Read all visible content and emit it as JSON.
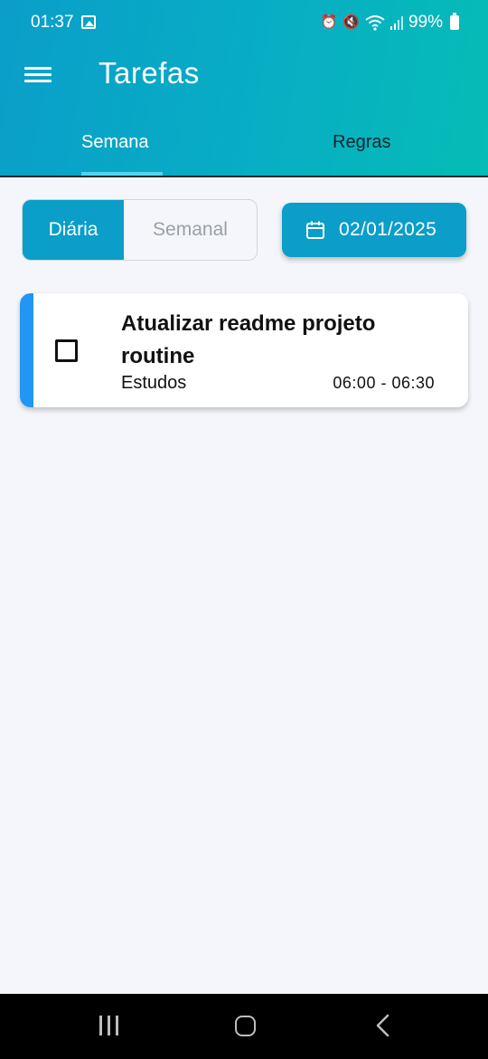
{
  "status_bar": {
    "time": "01:37",
    "battery": "99%",
    "icons": [
      "gallery-icon",
      "alarm-icon",
      "mute-icon",
      "wifi-icon",
      "signal-icon",
      "battery-icon"
    ]
  },
  "app_bar": {
    "title": "Tarefas",
    "menu_icon": "menu-icon"
  },
  "tabs": [
    {
      "label": "Semana",
      "active": true
    },
    {
      "label": "Regras",
      "active": false
    }
  ],
  "view_toggle": {
    "options": [
      {
        "label": "Diária",
        "selected": true
      },
      {
        "label": "Semanal",
        "selected": false
      }
    ]
  },
  "date_picker": {
    "icon": "calendar-icon",
    "value": "02/01/2025"
  },
  "tasks": [
    {
      "title": "Atualizar readme projeto routine",
      "category": "Estudos",
      "time": "06:00 - 06:30",
      "completed": false
    }
  ],
  "colors": {
    "primary": "#0a9ec9",
    "gradient_end": "#06bcb6",
    "task_accent": "#2196f3",
    "tab_indicator": "#4fd6ee",
    "background": "#f4f6fb"
  },
  "nav_bar": {
    "buttons": [
      "recents-icon",
      "home-icon",
      "back-icon"
    ]
  }
}
